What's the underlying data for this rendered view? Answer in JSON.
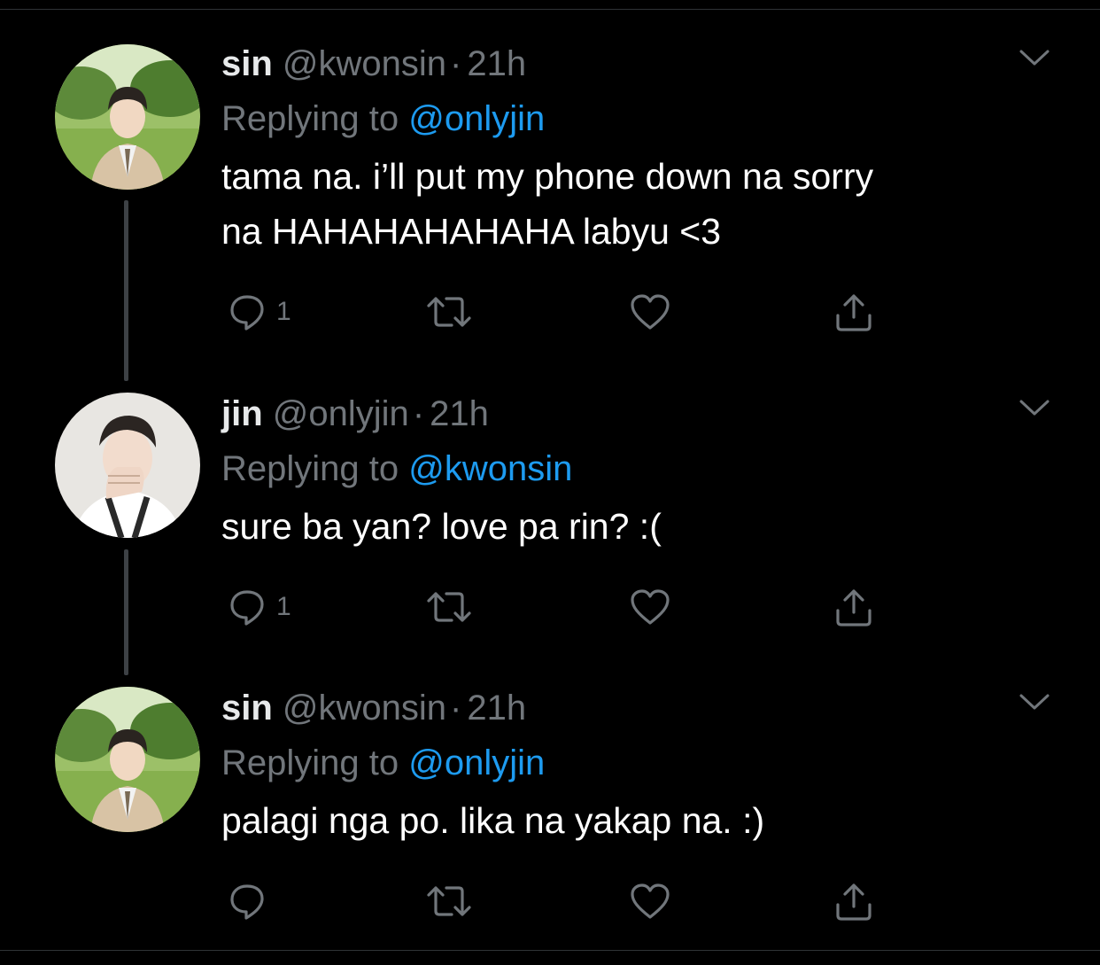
{
  "tweets": [
    {
      "name": "sin",
      "handle": "@kwonsin",
      "separator": "·",
      "time": "21h",
      "replying_prefix": "Replying to",
      "replying_to": "@onlyjin",
      "text_line1": "tama na. i’ll put my phone down na sorry",
      "text_line2": "na HAHAHAHAHAHA labyu <3",
      "reply_count": "1",
      "avatar": "outdoor-portrait-avatar"
    },
    {
      "name": "jin",
      "handle": "@onlyjin",
      "separator": "·",
      "time": "21h",
      "replying_prefix": "Replying to",
      "replying_to": "@kwonsin",
      "text_line1": "sure ba yan? love pa rin? :(",
      "reply_count": "1",
      "avatar": "monochrome-portrait-avatar"
    },
    {
      "name": "sin",
      "handle": "@kwonsin",
      "separator": "·",
      "time": "21h",
      "replying_prefix": "Replying to",
      "replying_to": "@onlyjin",
      "text_line1": "palagi nga po. lika na yakap na. :)",
      "reply_count": "",
      "avatar": "outdoor-portrait-avatar"
    }
  ],
  "icons": {
    "reply": "reply-icon",
    "retweet": "retweet-icon",
    "like": "heart-icon",
    "share": "share-icon",
    "more": "chevron-down-icon"
  },
  "colors": {
    "background": "#000000",
    "text": "#ffffff",
    "muted": "#71767b",
    "link": "#1d9bf0",
    "thread_line": "#3d4145"
  }
}
